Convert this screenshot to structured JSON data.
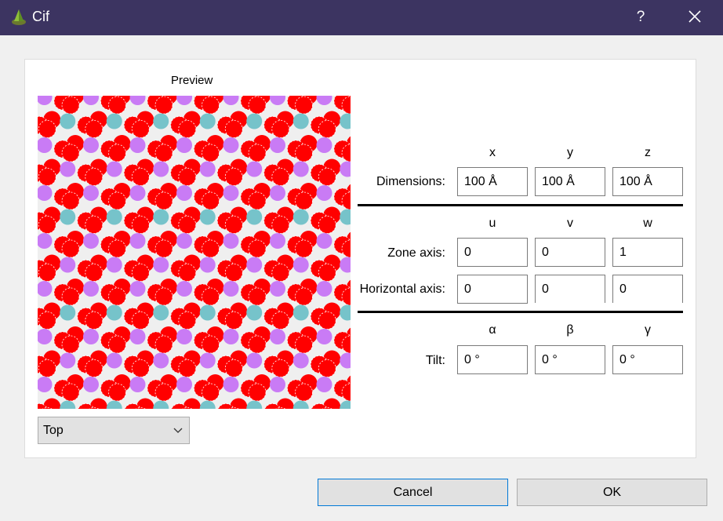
{
  "window": {
    "title": "Cif",
    "help_glyph": "?",
    "icons": {
      "app": "app-logo-icon",
      "close": "close-icon"
    },
    "titlebar_color": "#3c3461"
  },
  "preview": {
    "label": "Preview",
    "view_select": {
      "value": "Top",
      "icon": "chevron-down-icon"
    },
    "atom_colors": {
      "red": "#ff0000",
      "teal": "#76c3ca",
      "purple": "#c97bf5",
      "background": "#efefef"
    }
  },
  "dimensions": {
    "headers": [
      "x",
      "y",
      "z"
    ],
    "label": "Dimensions:",
    "values": [
      "100 Å",
      "100 Å",
      "100 Å"
    ]
  },
  "orientation": {
    "headers": [
      "u",
      "v",
      "w"
    ],
    "zone_axis": {
      "label": "Zone axis:",
      "values": [
        "0",
        "0",
        "1"
      ]
    },
    "horizontal_axis": {
      "label": "Horizontal axis:",
      "values": [
        "0",
        "0",
        "0"
      ]
    }
  },
  "tilt": {
    "headers": [
      "α",
      "β",
      "γ"
    ],
    "label": "Tilt:",
    "values": [
      "0 °",
      "0 °",
      "0 °"
    ]
  },
  "buttons": {
    "cancel": "Cancel",
    "ok": "OK"
  }
}
